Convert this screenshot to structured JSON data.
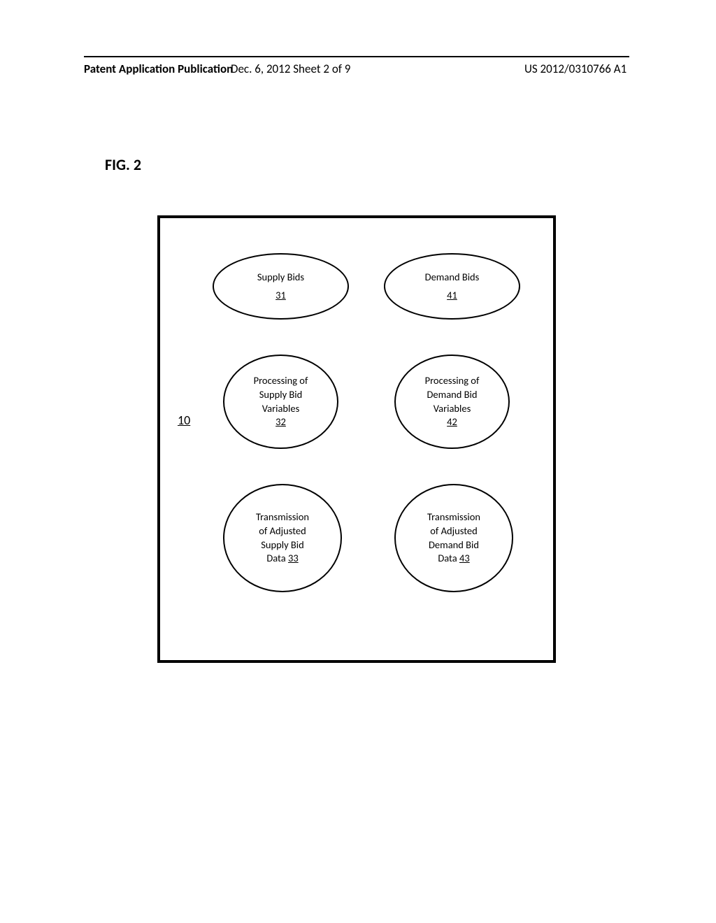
{
  "header": {
    "left": "Patent Application Publication",
    "center": "Dec. 6, 2012   Sheet 2 of 9",
    "right": "US 2012/0310766 A1"
  },
  "figure": {
    "label": "FIG. 2",
    "box_ref": "10"
  },
  "ellipses": {
    "supply_bids": {
      "title": "Supply Bids",
      "ref": "31"
    },
    "demand_bids": {
      "title": "Demand Bids",
      "ref": "41"
    },
    "supply_proc": {
      "l1": "Processing of",
      "l2": "Supply Bid",
      "l3": "Variables",
      "ref": "32"
    },
    "demand_proc": {
      "l1": "Processing of",
      "l2": "Demand Bid",
      "l3": "Variables",
      "ref": "42"
    },
    "supply_tx": {
      "l1": "Transmission",
      "l2": "of Adjusted",
      "l3": "Supply Bid",
      "l4": "Data",
      "ref": "33"
    },
    "demand_tx": {
      "l1": "Transmission",
      "l2": "of Adjusted",
      "l3": "Demand Bid",
      "l4": "Data",
      "ref": "43"
    }
  }
}
